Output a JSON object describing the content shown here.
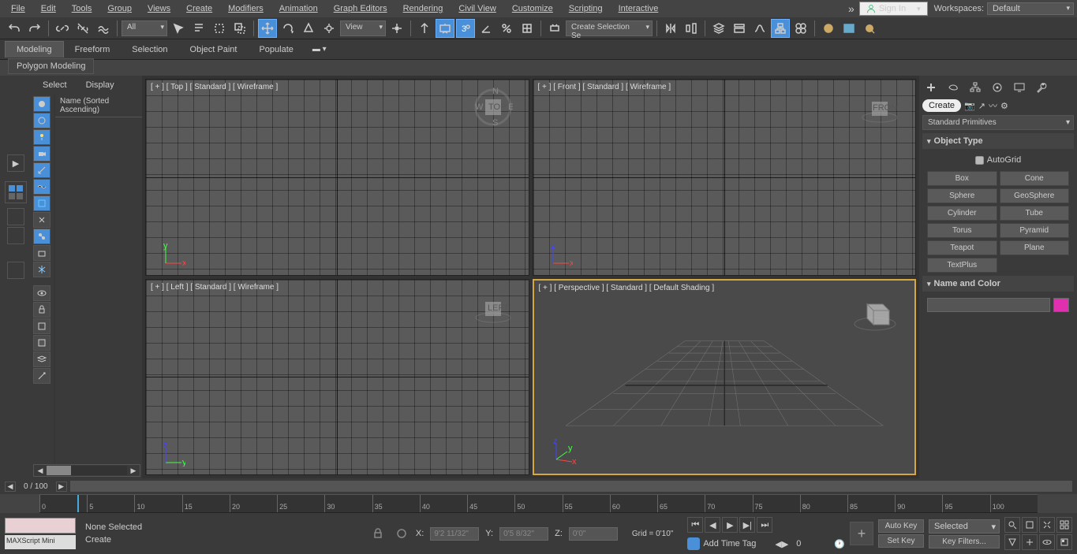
{
  "menu": [
    "File",
    "Edit",
    "Tools",
    "Group",
    "Views",
    "Create",
    "Modifiers",
    "Animation",
    "Graph Editors",
    "Rendering",
    "Civil View",
    "Customize",
    "Scripting",
    "Interactive"
  ],
  "signin": "Sign In",
  "workspaces_label": "Workspaces:",
  "workspaces_value": "Default",
  "toolbar": {
    "all": "All",
    "view": "View",
    "create_sel": "Create Selection Se"
  },
  "ribbon": {
    "tabs": [
      "Modeling",
      "Freeform",
      "Selection",
      "Object Paint",
      "Populate"
    ],
    "sub": "Polygon Modeling"
  },
  "scene": {
    "tabs": [
      "Select",
      "Display"
    ],
    "header": "Name (Sorted Ascending)"
  },
  "viewports": [
    {
      "label": "[ + ] [ Top ] [ Standard ] [ Wireframe ]",
      "axis": [
        "x",
        "y"
      ],
      "cube": "TOP"
    },
    {
      "label": "[ + ] [ Front ] [ Standard ] [ Wireframe ]",
      "axis": [
        "x",
        "z"
      ],
      "cube": "FRONT"
    },
    {
      "label": "[ + ] [ Left ] [ Standard ] [ Wireframe ]",
      "axis": [
        "y",
        "z"
      ],
      "cube": "LEFT"
    },
    {
      "label": "[ + ] [ Perspective ] [ Standard ] [ Default Shading ]",
      "axis": [
        "x",
        "y",
        "z"
      ],
      "cube": "",
      "active": true
    }
  ],
  "command": {
    "create_label": "Create",
    "dropdown": "Standard Primitives",
    "rollout_objtype": "Object Type",
    "autogrid": "AutoGrid",
    "buttons": [
      "Box",
      "Cone",
      "Sphere",
      "GeoSphere",
      "Cylinder",
      "Tube",
      "Torus",
      "Pyramid",
      "Teapot",
      "Plane",
      "TextPlus"
    ],
    "rollout_name": "Name and Color"
  },
  "timeline": {
    "pos": "0 / 100",
    "ticks": [
      0,
      5,
      10,
      15,
      20,
      25,
      30,
      35,
      40,
      45,
      50,
      55,
      60,
      65,
      70,
      75,
      80,
      85,
      90,
      95,
      100
    ]
  },
  "status": {
    "script": "MAXScript Mini",
    "sel": "None Selected",
    "prompt": "Create",
    "x_label": "X:",
    "x": "9'2 11/32\"",
    "y_label": "Y:",
    "y": "0'5 8/32\"",
    "z_label": "Z:",
    "z": "0'0\"",
    "grid": "Grid = 0'10\"",
    "timetag": "Add Time Tag",
    "autokey": "Auto Key",
    "setkey": "Set Key",
    "selected": "Selected",
    "keyfilters": "Key Filters...",
    "frame": "0"
  }
}
